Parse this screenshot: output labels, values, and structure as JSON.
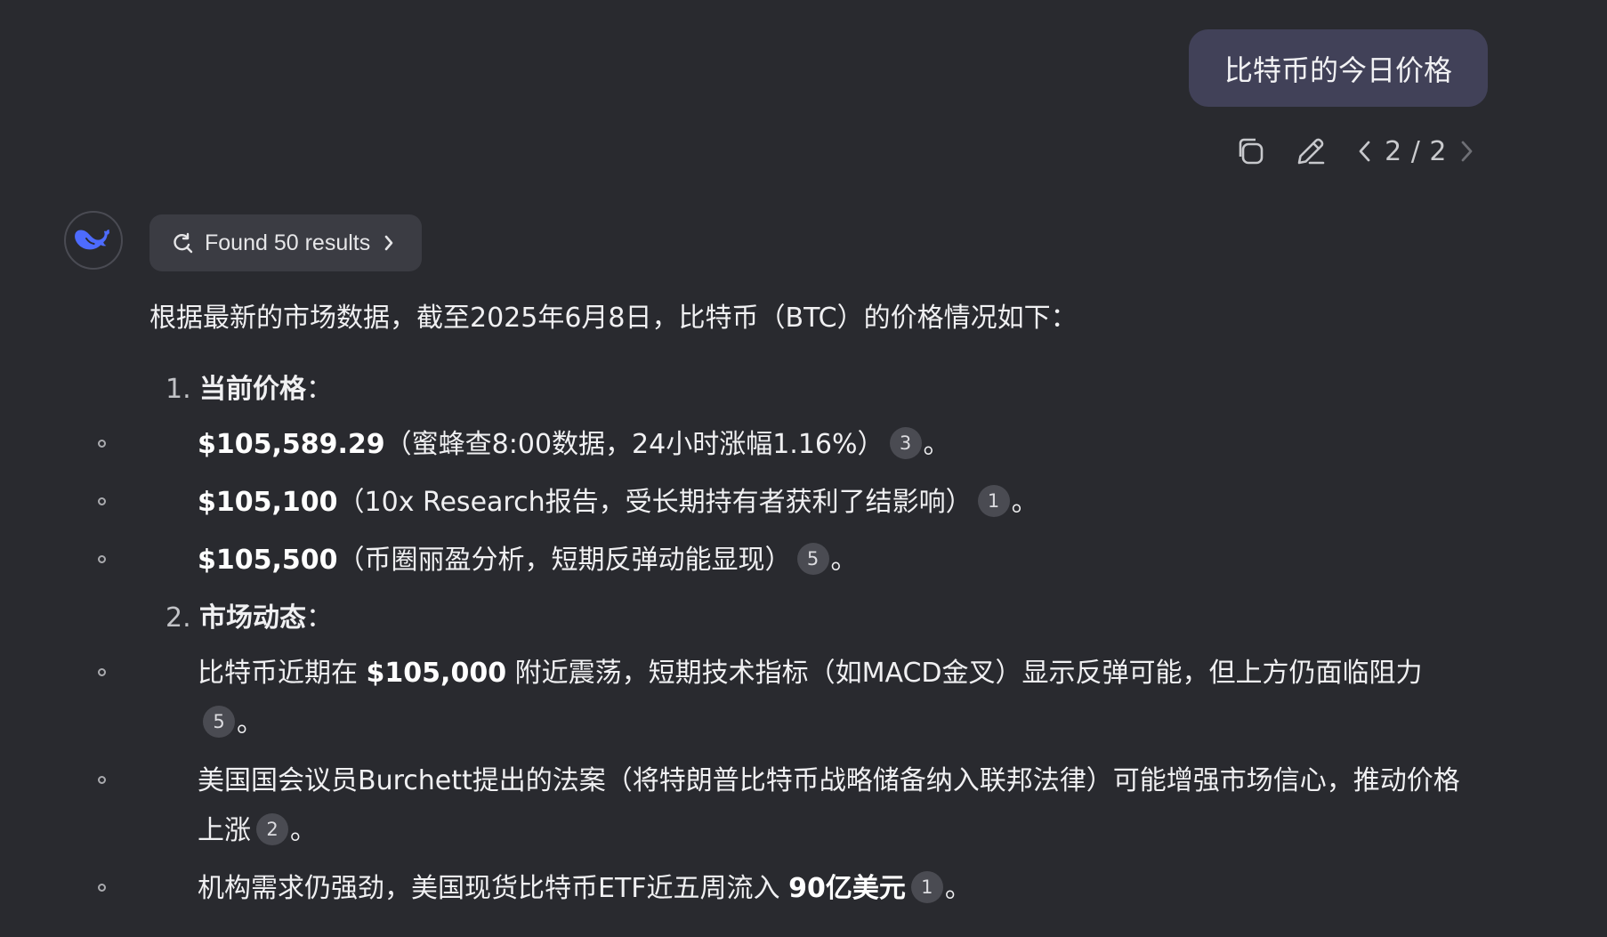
{
  "user_message": {
    "text": "比特币的今日价格",
    "pager": "2 / 2"
  },
  "icons": {
    "copy": "copy-icon",
    "edit": "pencil-icon",
    "prev": "chevron-left-icon",
    "next": "chevron-right-icon",
    "avatar": "deepseek-whale-icon",
    "search": "search-refresh-icon",
    "chip_arrow": "chevron-right-icon"
  },
  "search_chip": {
    "label": "Found 50 results"
  },
  "answer": {
    "intro": "根据最新的市场数据，截至2025年6月8日，比特币（BTC）的价格情况如下：",
    "sections": [
      {
        "num": "1.",
        "title": "当前价格",
        "colon": "：",
        "items": [
          {
            "bold": "$105,589.29",
            "text": "（蜜蜂查8:00数据，24小时涨幅1.16%）",
            "cite": "3",
            "end": "。"
          },
          {
            "bold": "$105,100",
            "text": "（10x Research报告，受长期持有者获利了结影响）",
            "cite": "1",
            "end": "。"
          },
          {
            "bold": "$105,500",
            "text": "（币圈丽盈分析，短期反弹动能显现）",
            "cite": "5",
            "end": "。"
          }
        ]
      },
      {
        "num": "2.",
        "title": "市场动态",
        "colon": "：",
        "items": [
          {
            "pre": "比特币近期在 ",
            "bold": "$105,000",
            "text": " 附近震荡，短期技术指标（如MACD金叉）显示反弹可能，但上方仍面临阻力",
            "cite": "5",
            "end": "。"
          },
          {
            "text": "美国国会议员Burchett提出的法案（将特朗普比特币战略储备纳入联邦法律）可能增强市场信心，推动价格上涨",
            "cite": "2",
            "end": "。"
          },
          {
            "pre": "机构需求仍强劲，美国现货比特币ETF近五周流入 ",
            "bold": "90亿美元",
            "cite": "1",
            "end": "。"
          }
        ]
      }
    ]
  },
  "colors": {
    "background": "#292a2f",
    "user_bubble": "#414158",
    "chip_bg": "#3b3c43",
    "cite_bg": "#4a4b52",
    "accent_blue": "#4d6bfe"
  }
}
